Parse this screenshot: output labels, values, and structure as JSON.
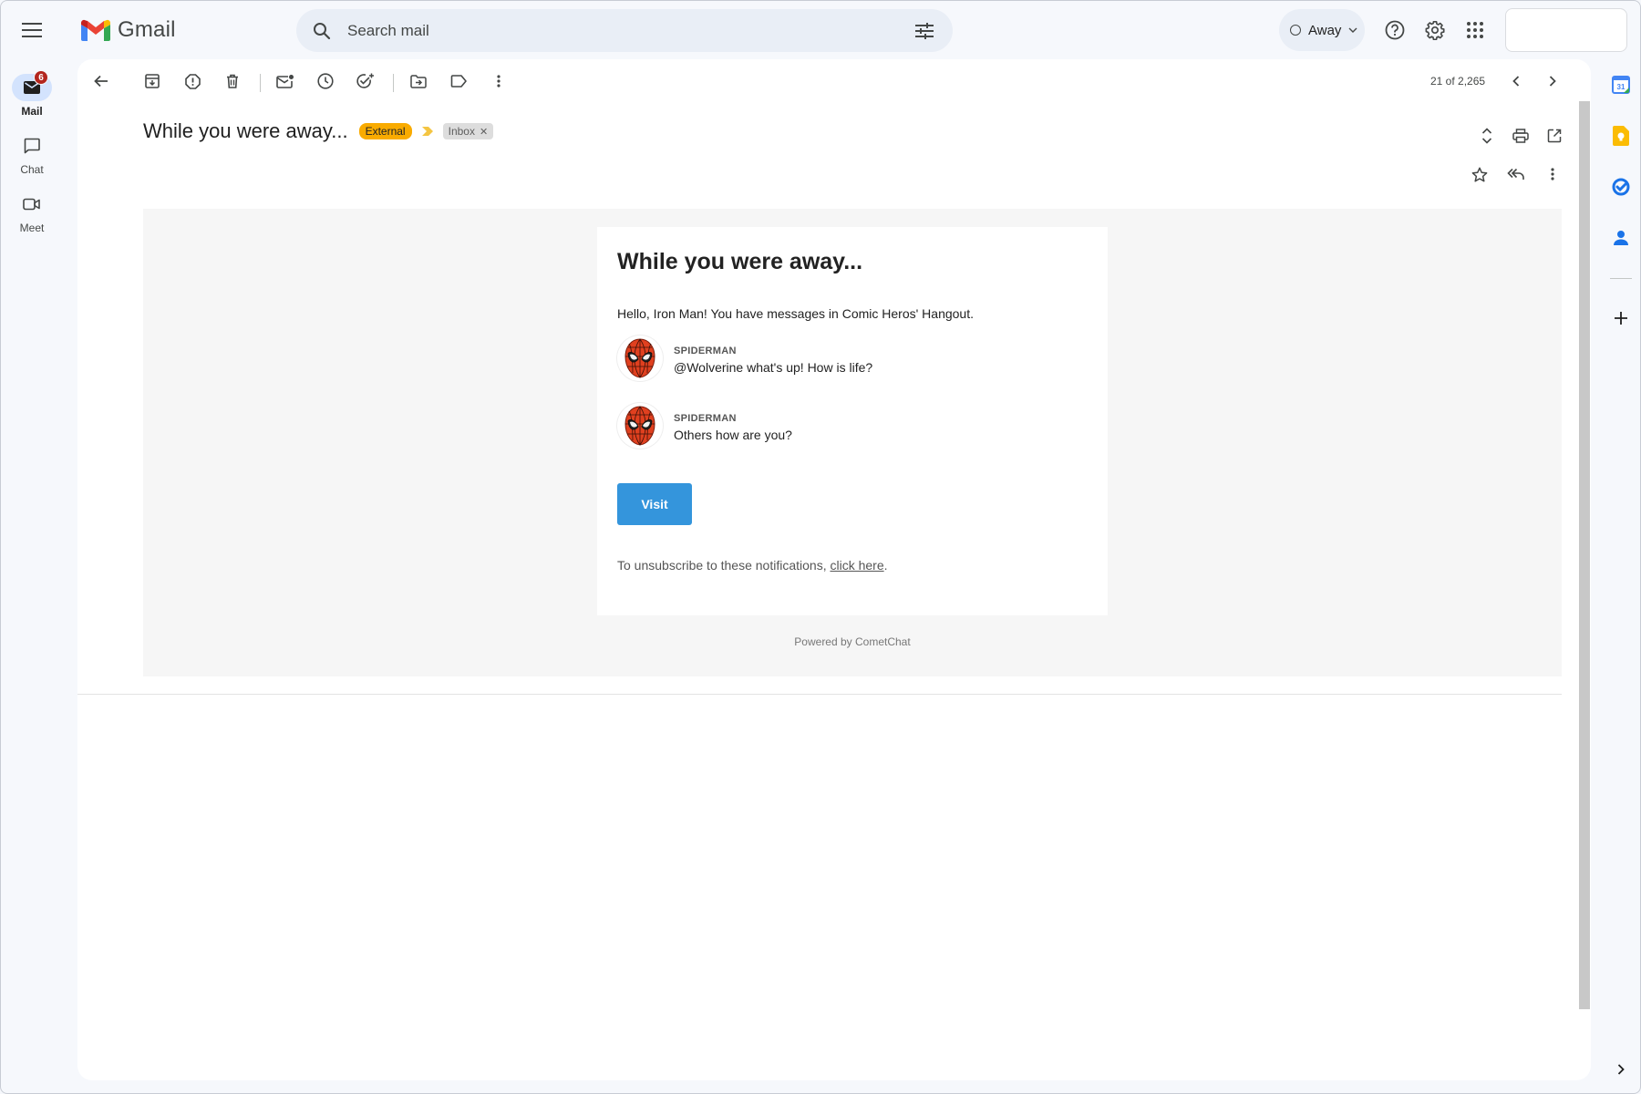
{
  "app": {
    "name": "Gmail"
  },
  "search": {
    "placeholder": "Search mail"
  },
  "status": {
    "label": "Away"
  },
  "rail": {
    "mail_label": "Mail",
    "mail_badge": "6",
    "chat_label": "Chat",
    "meet_label": "Meet"
  },
  "toolbar": {
    "pager": "21 of 2,265"
  },
  "email": {
    "subject": "While you were away...",
    "label_external": "External",
    "label_inbox": "Inbox",
    "card_title": "While you were away...",
    "greeting": "Hello, Iron Man! You have messages in Comic Heros' Hangout.",
    "messages": [
      {
        "sender": "SPIDERMAN",
        "text": "@Wolverine what's up! How is life?"
      },
      {
        "sender": "SPIDERMAN",
        "text": "Others how are you?"
      }
    ],
    "visit_label": "Visit",
    "unsubscribe_prefix": "To unsubscribe to these notifications, ",
    "unsubscribe_link": "click here",
    "unsubscribe_suffix": ".",
    "powered_by": "Powered by CometChat"
  },
  "colors": {
    "external_label": "#f9ab00",
    "visit_button": "#3495dc",
    "badge": "#b3261e",
    "active_rail": "#d3e3fd"
  }
}
